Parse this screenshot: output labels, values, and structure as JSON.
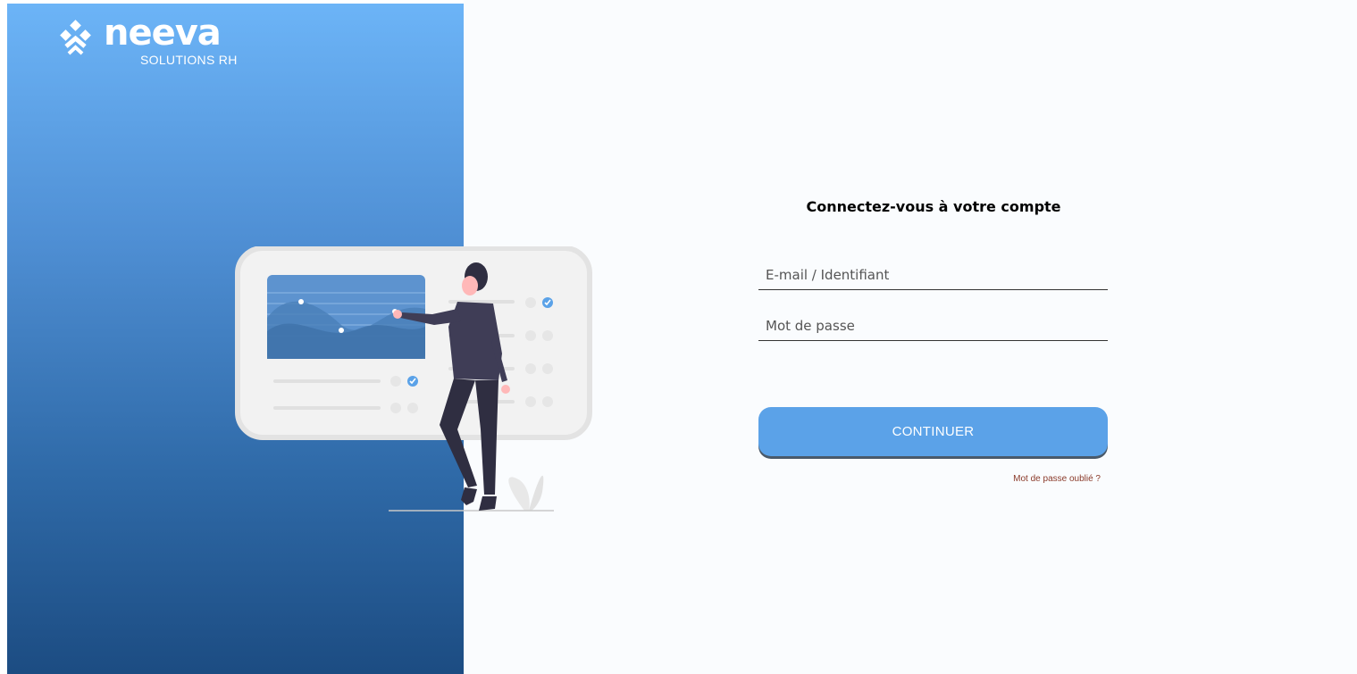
{
  "brand": {
    "name": "neeva",
    "tagline": "SOLUTIONS RH",
    "logo_icon": "neeva-logo-icon"
  },
  "illustration": {
    "name": "person-presenting-dashboard-illustration"
  },
  "login": {
    "title": "Connectez-vous à votre compte",
    "email_placeholder": "E-mail / Identifiant",
    "email_value": "",
    "password_placeholder": "Mot de passe",
    "password_value": "",
    "continue_label": "CONTINUER",
    "forgot_password_label": "Mot de passe oublié ?"
  },
  "colors": {
    "panel_gradient_top": "#6cb4f7",
    "panel_gradient_bottom": "#1c4c82",
    "button": "#5ba2e8",
    "forgot_link": "#8a3a2a"
  }
}
